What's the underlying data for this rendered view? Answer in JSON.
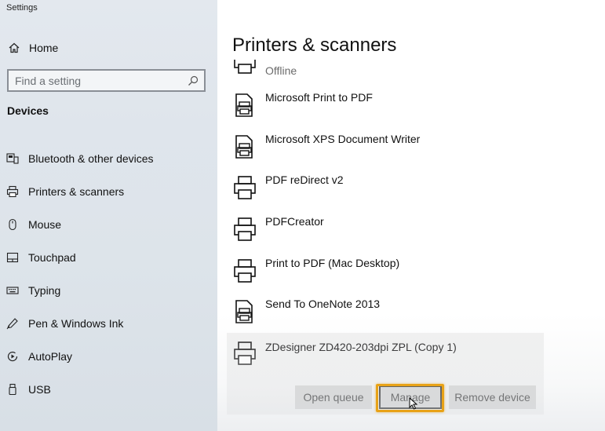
{
  "window": {
    "title": "Settings"
  },
  "sidebar": {
    "home_label": "Home",
    "search_placeholder": "Find a setting",
    "section_heading": "Devices",
    "items": [
      {
        "label": "Bluetooth & other devices",
        "icon": "bluetooth-devices-icon"
      },
      {
        "label": "Printers & scanners",
        "icon": "printer-icon"
      },
      {
        "label": "Mouse",
        "icon": "mouse-icon"
      },
      {
        "label": "Touchpad",
        "icon": "touchpad-icon"
      },
      {
        "label": "Typing",
        "icon": "keyboard-icon"
      },
      {
        "label": "Pen & Windows Ink",
        "icon": "pen-icon"
      },
      {
        "label": "AutoPlay",
        "icon": "autoplay-icon"
      },
      {
        "label": "USB",
        "icon": "usb-icon"
      }
    ]
  },
  "main": {
    "title": "Printers & scanners",
    "partial_item": {
      "status": "Offline",
      "icon": "printer-icon"
    },
    "printers": [
      {
        "name": "Microsoft Print to PDF",
        "icon": "document-printer-icon"
      },
      {
        "name": "Microsoft XPS Document Writer",
        "icon": "document-printer-icon"
      },
      {
        "name": "PDF reDirect v2",
        "icon": "printer-icon"
      },
      {
        "name": "PDFCreator",
        "icon": "printer-icon"
      },
      {
        "name": "Print to PDF (Mac Desktop)",
        "icon": "printer-icon"
      },
      {
        "name": "Send To OneNote 2013",
        "icon": "document-printer-icon"
      }
    ],
    "selected_printer": {
      "name": "ZDesigner ZD420-203dpi ZPL (Copy 1)",
      "icon": "printer-icon",
      "buttons": {
        "open_queue": "Open queue",
        "manage": "Manage",
        "remove_device": "Remove device"
      }
    }
  },
  "colors": {
    "highlight": "#e8a217",
    "button_bg": "#cccccc",
    "selected_bg": "#f0f0f0"
  }
}
